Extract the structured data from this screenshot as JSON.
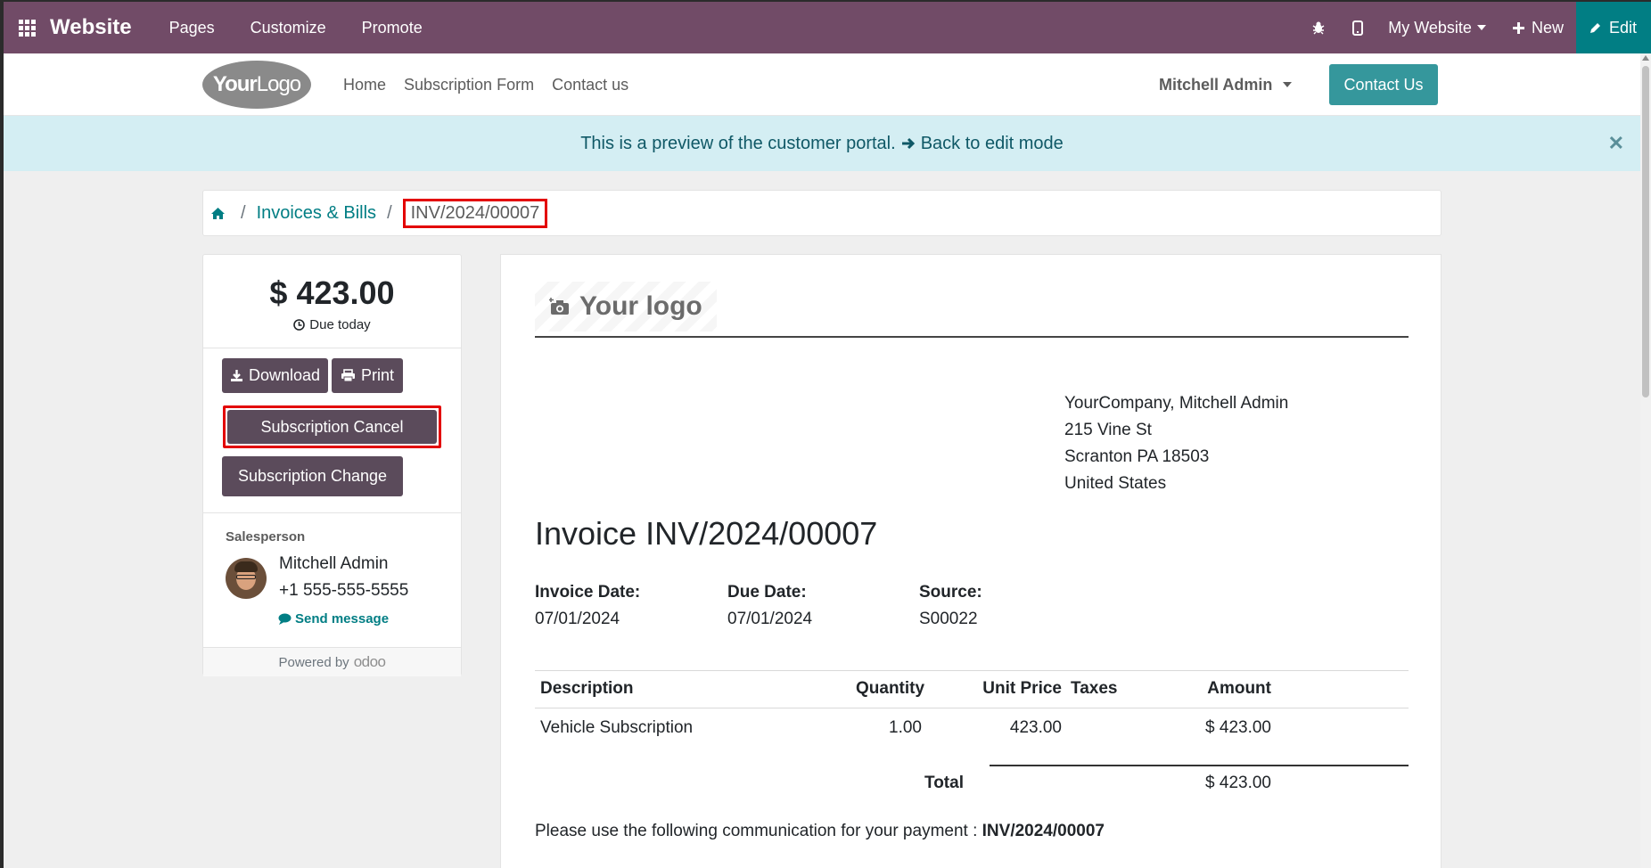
{
  "systray": {
    "app_title": "Website",
    "menu": [
      "Pages",
      "Customize",
      "Promote"
    ],
    "website_selector": "My Website",
    "new_label": "New",
    "edit_label": "Edit"
  },
  "header": {
    "logo_text_bold": "Your",
    "logo_text": "Logo",
    "nav": [
      "Home",
      "Subscription Form",
      "Contact us"
    ],
    "user_name": "Mitchell Admin",
    "cta_label": "Contact Us"
  },
  "alert": {
    "text": "This is a preview of the customer portal.",
    "link": "Back to edit mode"
  },
  "breadcrumb": {
    "section": "Invoices & Bills",
    "current": "INV/2024/00007"
  },
  "sidebar": {
    "amount": "$ 423.00",
    "due": "Due today",
    "download_label": "Download",
    "print_label": "Print",
    "cancel_label": "Subscription Cancel",
    "change_label": "Subscription Change",
    "salesperson_label": "Salesperson",
    "salesperson_name": "Mitchell Admin",
    "salesperson_phone": "+1 555-555-5555",
    "send_message": "Send message",
    "powered_by": "Powered by",
    "odoo_brand": "odoo"
  },
  "invoice": {
    "logo_placeholder": "Your logo",
    "address": [
      "YourCompany, Mitchell Admin",
      "215 Vine St",
      "Scranton PA 18503",
      "United States"
    ],
    "title": "Invoice INV/2024/00007",
    "invoice_date_label": "Invoice Date:",
    "invoice_date": "07/01/2024",
    "due_date_label": "Due Date:",
    "due_date": "07/01/2024",
    "source_label": "Source:",
    "source": "S00022",
    "columns": [
      "Description",
      "Quantity",
      "Unit Price",
      "Taxes",
      "Amount"
    ],
    "lines": [
      {
        "description": "Vehicle Subscription",
        "quantity": "1.00",
        "unit_price": "423.00",
        "taxes": "",
        "amount": "$ 423.00"
      }
    ],
    "total_label": "Total",
    "total": "$ 423.00",
    "communication_text": "Please use the following communication for your payment :",
    "communication_ref": "INV/2024/00007"
  },
  "colors": {
    "systray_bg": "#714b67",
    "edit_bg": "#017e84",
    "cta_bg": "#35979c",
    "button_dark": "#5b4b5b",
    "highlight": "#e30000",
    "alert_bg": "#d4eef3"
  }
}
